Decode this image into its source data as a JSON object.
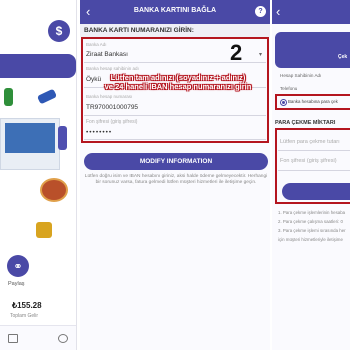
{
  "left": {
    "coin_symbol": "$",
    "share_label": "Paylaş",
    "earnings_value": "₺155.28",
    "earnings_label": "Toplam Gelir"
  },
  "middle": {
    "title": "BANKA KARTINI BAĞLA",
    "section_title": "BANKA KARTI NUMARANIZI GİRİN:",
    "bank_label": "Banka Adı",
    "bank_value": "Ziraat Bankası",
    "name_label": "Banka hesap sahibinin adı",
    "name_value": "Öykü",
    "iban_label": "Banka hesap numarası",
    "iban_value": "TR970001000795",
    "password_placeholder": "Fon şifresi (giriş şifresi)",
    "password_value": "••••••••",
    "annotation_number": "2",
    "annotation_line1": "Lütfen tam adınızı (soyadınız + adınız)",
    "annotation_line2": "ve 24 haneli IBAN hesap numaranızı girin",
    "modify_button": "MODIFY INFORMATION",
    "note": "Lütfen doğru isim ve IBAN hesabını giriniz, aksi halde ödeme gelmeyecektir. Herhangi bir sorunuz varsa, fatura gelmedi lütfen müşteri hizmetleri ile iletişime geçin."
  },
  "right": {
    "card_label": "Çek",
    "holder_label": "Hesap Sahibinin Adı",
    "phone_label": "Telefonu",
    "radio_label": "Banka hesabına para çek",
    "section_title": "PARA ÇEKME MİKTARI",
    "amount_placeholder": "Lütfen para çekme tutarı",
    "password_placeholder": "Fon şifresi (giriş şifresi)",
    "note1": "1. Para çekme işlemlerinin hesaba",
    "note2": "2. Para çekme çalışma saatleri: 0",
    "note3": "3. Para çekme işlemi sırasında her",
    "note4": "için müşteri hizmetleriyle iletişime"
  },
  "colors": {
    "brand": "#4a49a6",
    "annotation_red": "#b4151f"
  }
}
